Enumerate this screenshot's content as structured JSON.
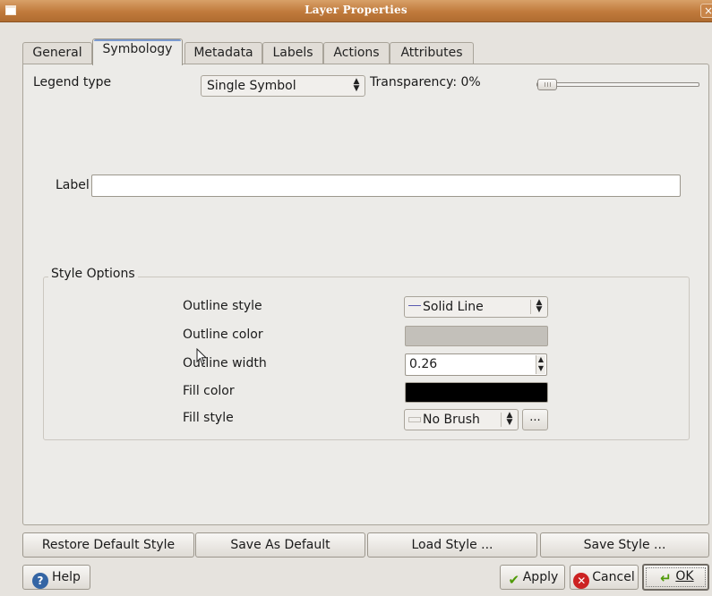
{
  "window": {
    "title": "Layer Properties",
    "close_glyph": "×"
  },
  "tabs": [
    {
      "label": "General",
      "active": false
    },
    {
      "label": "Symbology",
      "active": true
    },
    {
      "label": "Metadata",
      "active": false
    },
    {
      "label": "Labels",
      "active": false
    },
    {
      "label": "Actions",
      "active": false
    },
    {
      "label": "Attributes",
      "active": false
    }
  ],
  "symbology": {
    "legend_type_label": "Legend type",
    "legend_type_value": "Single Symbol",
    "transparency_label": "Transparency: 0%",
    "transparency_value": 0,
    "label_label": "Label",
    "label_value": ""
  },
  "style_options": {
    "title": "Style Options",
    "outline_style_label": "Outline style",
    "outline_style_value": "Solid Line",
    "outline_color_label": "Outline color",
    "outline_color": "#c3c0ba",
    "outline_width_label": "Outline width",
    "outline_width_value": "0.26",
    "fill_color_label": "Fill color",
    "fill_color": "#000000",
    "fill_style_label": "Fill style",
    "fill_style_value": "No Brush",
    "more_button_label": "..."
  },
  "style_buttons": {
    "restore": "Restore Default Style",
    "save_default": "Save As Default",
    "load": "Load Style ...",
    "save": "Save Style ..."
  },
  "dialog_buttons": {
    "help": "Help",
    "apply": "Apply",
    "cancel": "Cancel",
    "ok": "OK"
  },
  "icons": {
    "help": "help-icon",
    "apply": "checkmark-icon",
    "cancel": "cancel-icon",
    "ok": "ok-arrow-icon"
  }
}
